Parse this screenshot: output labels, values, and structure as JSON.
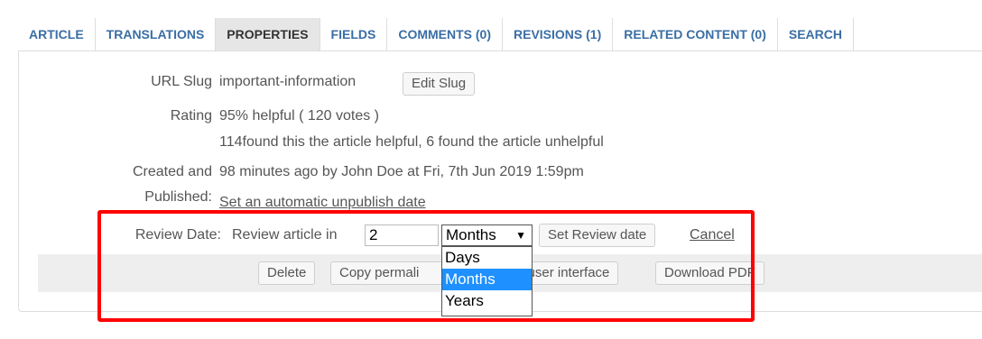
{
  "tabs": [
    {
      "label": "ARTICLE"
    },
    {
      "label": "TRANSLATIONS"
    },
    {
      "label": "PROPERTIES"
    },
    {
      "label": "FIELDS"
    },
    {
      "label": "COMMENTS (0)"
    },
    {
      "label": "REVISIONS (1)"
    },
    {
      "label": "RELATED CONTENT (0)"
    },
    {
      "label": "SEARCH"
    }
  ],
  "url_slug": {
    "label": "URL Slug",
    "value": "important-information",
    "edit_button": "Edit Slug"
  },
  "rating": {
    "label": "Rating",
    "value": "95% helpful ( 120 votes )",
    "detail": "114found this the article helpful, 6 found the article unhelpful"
  },
  "created": {
    "label_line1": "Created and",
    "label_line2": "Published:",
    "value": "98 minutes ago by John Doe at Fri, 7th Jun 2019 1:59pm",
    "unpublish_link": "Set an automatic unpublish date"
  },
  "review": {
    "label": "Review Date:",
    "prefix": "Review article in",
    "amount": "2",
    "unit_selected": "Months",
    "unit_options": [
      "Days",
      "Months",
      "Years"
    ],
    "set_button": "Set Review date",
    "cancel_link": "Cancel"
  },
  "toolbar": {
    "delete": "Delete",
    "copy_permalink": "Copy permali",
    "user_interface": "n user interface",
    "download_pdf": "Download PDF"
  },
  "colors": {
    "highlight": "#ff0000",
    "tab_text": "#3a6ea5",
    "selected_option": "#1e90ff"
  }
}
